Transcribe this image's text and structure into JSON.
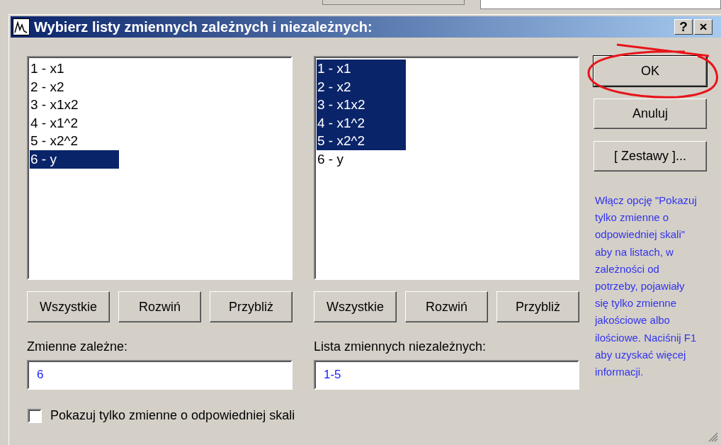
{
  "window": {
    "title": "Wybierz listy zmiennych zależnych i niezależnych:",
    "title_buttons": [
      "?",
      "×"
    ]
  },
  "lists": [
    {
      "items": [
        {
          "label": "1 - x1",
          "selected": false
        },
        {
          "label": "2 - x2",
          "selected": false
        },
        {
          "label": "3 - x1x2",
          "selected": false
        },
        {
          "label": "4 - x1^2",
          "selected": false
        },
        {
          "label": "5 - x2^2",
          "selected": false
        },
        {
          "label": "6 - y",
          "selected": true
        }
      ],
      "buttons": [
        "Wszystkie",
        "Rozwiń",
        "Przybliż"
      ],
      "field_label": "Zmienne zależne:",
      "field_value": "6"
    },
    {
      "items": [
        {
          "label": "1 - x1",
          "selected": true
        },
        {
          "label": "2 - x2",
          "selected": true
        },
        {
          "label": "3 - x1x2",
          "selected": true
        },
        {
          "label": "4 - x1^2",
          "selected": true
        },
        {
          "label": "5 - x2^2",
          "selected": true
        },
        {
          "label": "6 - y",
          "selected": false
        }
      ],
      "buttons": [
        "Wszystkie",
        "Rozwiń",
        "Przybliż"
      ],
      "field_label": "Lista zmiennych niezależnych:",
      "field_value": "1-5"
    }
  ],
  "checkbox": {
    "label": "Pokazuj tylko zmienne o odpowiedniej skali",
    "checked": false
  },
  "buttons": [
    {
      "label": "OK",
      "default": true
    },
    {
      "label": "Anuluj",
      "default": false
    },
    {
      "label": "[ Zestawy ]...",
      "default": false
    }
  ],
  "hint": "Włącz opcję \"Pokazuj tylko zmienne o odpowiedniej skali\" aby na listach, w zależności od potrzeby, pojawiały się tylko zmienne jakościowe albo ilościowe. Naciśnij F1 aby uzyskać więcej informacji."
}
